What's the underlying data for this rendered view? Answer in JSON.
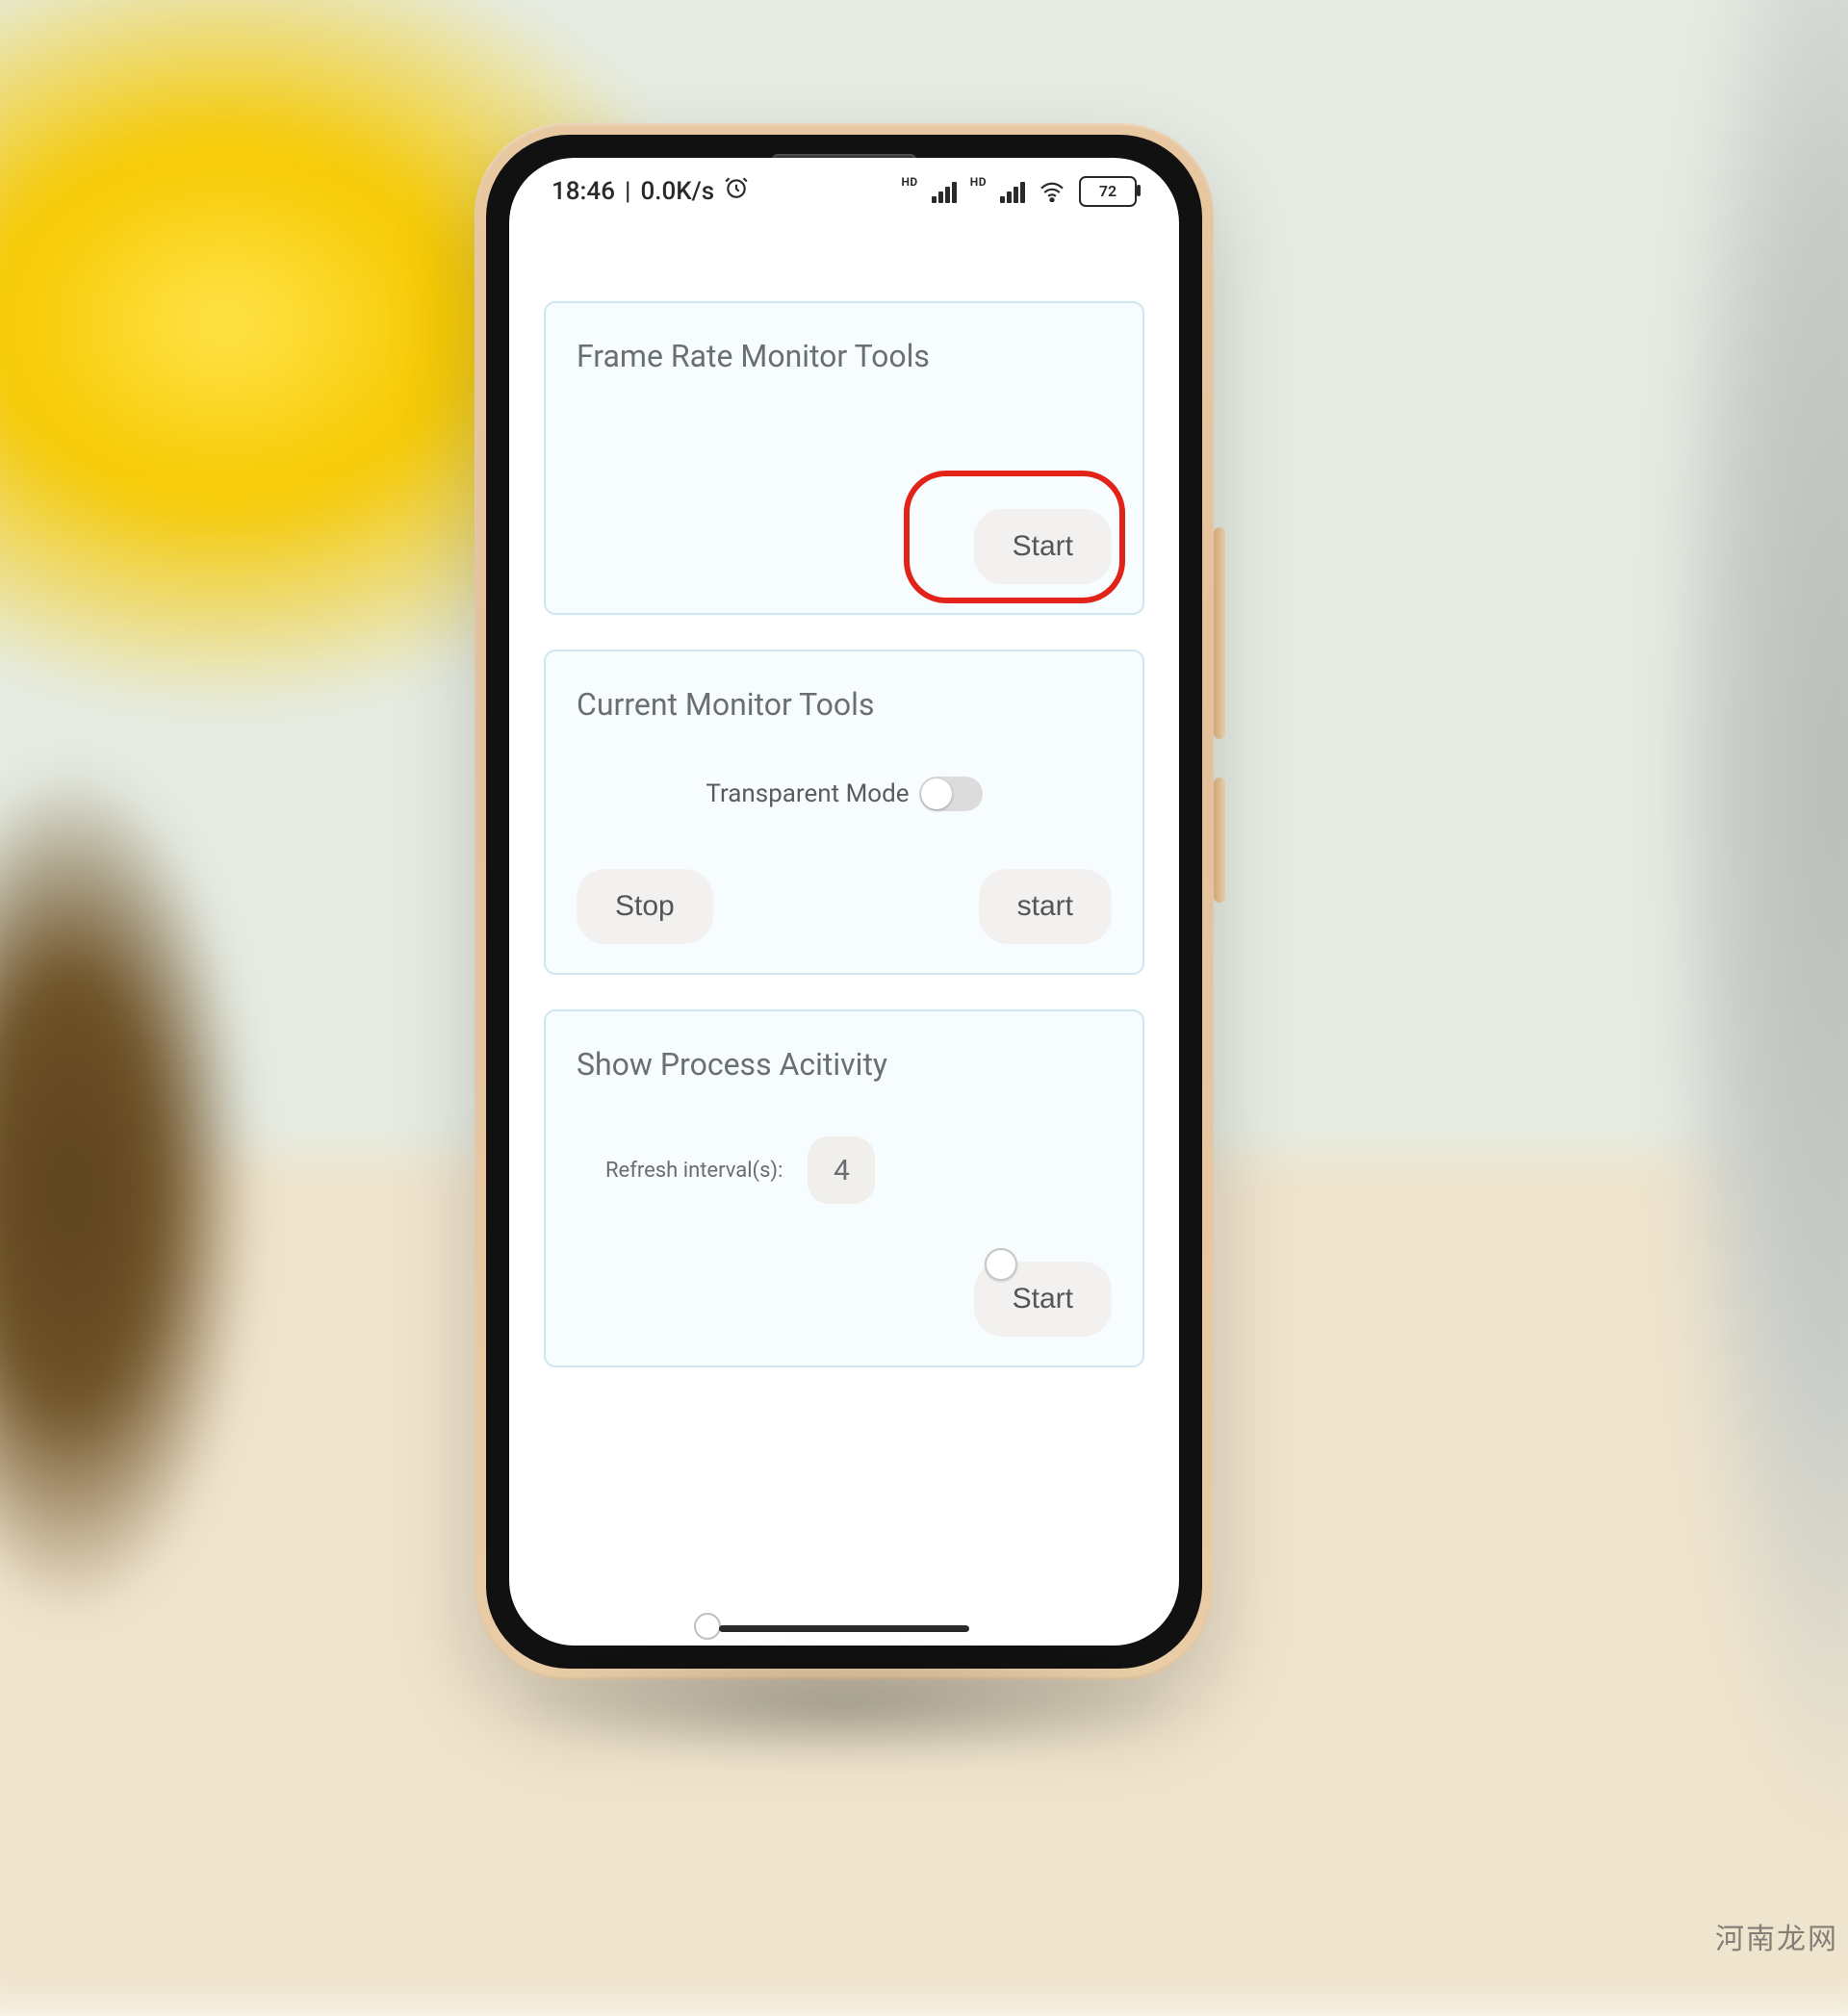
{
  "statusbar": {
    "time": "18:46",
    "net_speed": "0.0K/s",
    "alarm_icon": "alarm-icon",
    "hd1": "HD",
    "hd2": "HD",
    "battery": "72"
  },
  "cards": {
    "frame_rate": {
      "title": "Frame Rate Monitor Tools",
      "start": "Start"
    },
    "current": {
      "title": "Current Monitor Tools",
      "transparent_label": "Transparent Mode",
      "stop": "Stop",
      "start": "start"
    },
    "process": {
      "title": "Show Process Acitivity",
      "refresh_label": "Refresh interval(s):",
      "refresh_value": "4",
      "start": "Start"
    }
  },
  "watermark": "河南龙网"
}
